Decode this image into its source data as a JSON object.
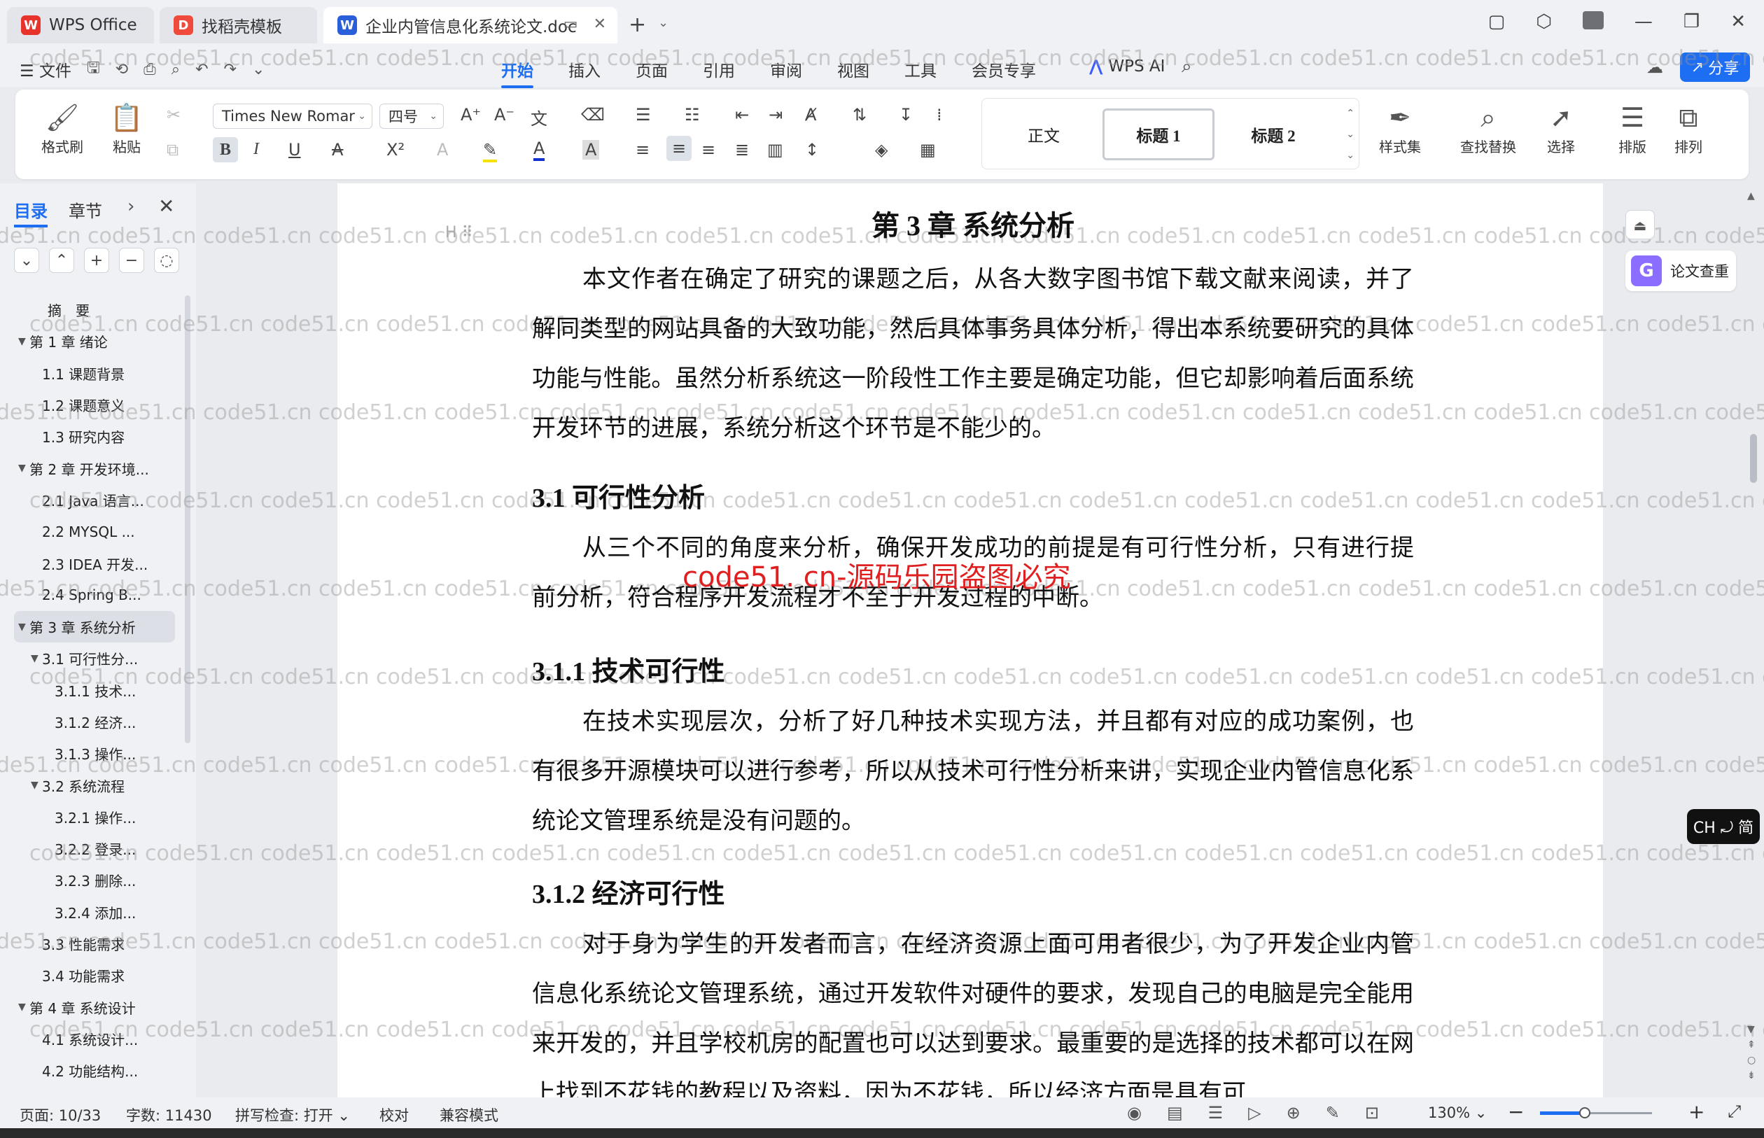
{
  "titlebar": {
    "tabs": [
      {
        "label": "WPS Office",
        "icon": "wps-logo"
      },
      {
        "label": "找稻壳模板",
        "icon": "docer-logo"
      },
      {
        "label": "企业内管信息化系统论文.doc",
        "icon": "word-doc"
      }
    ],
    "new_tab": "+"
  },
  "menubar": {
    "file": "文件",
    "tabs": [
      "开始",
      "插入",
      "页面",
      "引用",
      "审阅",
      "视图",
      "工具",
      "会员专享"
    ],
    "active_tab": "开始",
    "wps_ai": "WPS AI",
    "share": "分享"
  },
  "ribbon": {
    "format_painter": "格式刷",
    "paste": "粘贴",
    "font_name": "Times New Romar",
    "font_size": "四号",
    "styles": [
      "正文",
      "标题 1",
      "标题 2"
    ],
    "style_set": "样式集",
    "find_replace": "查找替换",
    "select": "选择",
    "layout": "排版",
    "arrange": "排列"
  },
  "sidebar": {
    "tabs": [
      "目录",
      "章节"
    ],
    "active_tab": "目录",
    "toc": [
      {
        "label": "摘　要",
        "level": 0,
        "arrow": false
      },
      {
        "label": "第 1 章  绪论",
        "level": 0,
        "arrow": true
      },
      {
        "label": "1.1  课题背景",
        "level": 1,
        "arrow": false
      },
      {
        "label": "1.2  课题意义",
        "level": 1,
        "arrow": false
      },
      {
        "label": "1.3  研究内容",
        "level": 1,
        "arrow": false
      },
      {
        "label": "第 2 章  开发环境...",
        "level": 0,
        "arrow": true
      },
      {
        "label": "2.1 Java 语言...",
        "level": 1,
        "arrow": false
      },
      {
        "label": "2.2 MYSQL ...",
        "level": 1,
        "arrow": false
      },
      {
        "label": "2.3 IDEA 开发...",
        "level": 1,
        "arrow": false
      },
      {
        "label": "2.4 Spring B...",
        "level": 1,
        "arrow": false
      },
      {
        "label": "第 3 章  系统分析",
        "level": 0,
        "arrow": true,
        "active": true
      },
      {
        "label": "3.1  可行性分...",
        "level": 1,
        "arrow": true
      },
      {
        "label": "3.1.1  技术...",
        "level": 2,
        "arrow": false
      },
      {
        "label": "3.1.2  经济...",
        "level": 2,
        "arrow": false
      },
      {
        "label": "3.1.3  操作...",
        "level": 2,
        "arrow": false
      },
      {
        "label": "3.2  系统流程",
        "level": 1,
        "arrow": true
      },
      {
        "label": "3.2.1  操作...",
        "level": 2,
        "arrow": false
      },
      {
        "label": "3.2.2  登录...",
        "level": 2,
        "arrow": false
      },
      {
        "label": "3.2.3  删除...",
        "level": 2,
        "arrow": false
      },
      {
        "label": "3.2.4  添加...",
        "level": 2,
        "arrow": false
      },
      {
        "label": "3.3  性能需求",
        "level": 1,
        "arrow": false
      },
      {
        "label": "3.4  功能需求",
        "level": 1,
        "arrow": false
      },
      {
        "label": "第 4 章  系统设计",
        "level": 0,
        "arrow": true
      },
      {
        "label": "4.1  系统设计...",
        "level": 1,
        "arrow": false
      },
      {
        "label": "4.2  功能结构...",
        "level": 1,
        "arrow": false
      }
    ]
  },
  "document": {
    "chapter_title": "第 3 章  系统分析",
    "p1": "本文作者在确定了研究的课题之后，从各大数字图书馆下载文献来阅读，并了解同类型的网站具备的大致功能，然后具体事务具体分析，得出本系统要研究的具体功能与性能。虽然分析系统这一阶段性工作主要是确定功能，但它却影响着后面系统开发环节的进展，系统分析这个环节是不能少的。",
    "h_31": "3.1  可行性分析",
    "p2": "从三个不同的角度来分析，确保开发成功的前提是有可行性分析，只有进行提前分析，符合程序开发流程才不至于开发过程的中断。",
    "h_311": "3.1.1  技术可行性",
    "p3": "在技术实现层次，分析了好几种技术实现方法，并且都有对应的成功案例，也有很多开源模块可以进行参考，所以从技术可行性分析来讲，实现企业内管信息化系统论文管理系统是没有问题的。",
    "h_312": "3.1.2  经济可行性",
    "p4": "对于身为学生的开发者而言，在经济资源上面可用者很少，为了开发企业内管信息化系统论文管理系统，通过开发软件对硬件的要求，发现自己的电脑是完全能用来开发的，并且学校机房的配置也可以达到要求。最重要的是选择的技术都可以在网上找到不花钱的教程以及资料，因为不花钱，所以经济方面是具有可",
    "red_watermark": "code51. cn-源码乐园盗图必究",
    "watermark": "code51.cn",
    "heading_marker": "H"
  },
  "right_panel": {
    "check_label": "论文查重",
    "ime": "CH ⤾ 简"
  },
  "statusbar": {
    "page": "页面: 10/33",
    "words": "字数: 11430",
    "spell": "拼写检查: 打开",
    "proof": "校对",
    "compat": "兼容模式",
    "zoom": "130%",
    "zoom_fraction": 0.4
  },
  "colors": {
    "accent": "#1d6ef2",
    "watermark_red": "#e02020",
    "wps_red": "#e8332c",
    "docer_red": "#f04a3c",
    "word_blue": "#2b5fd9"
  }
}
